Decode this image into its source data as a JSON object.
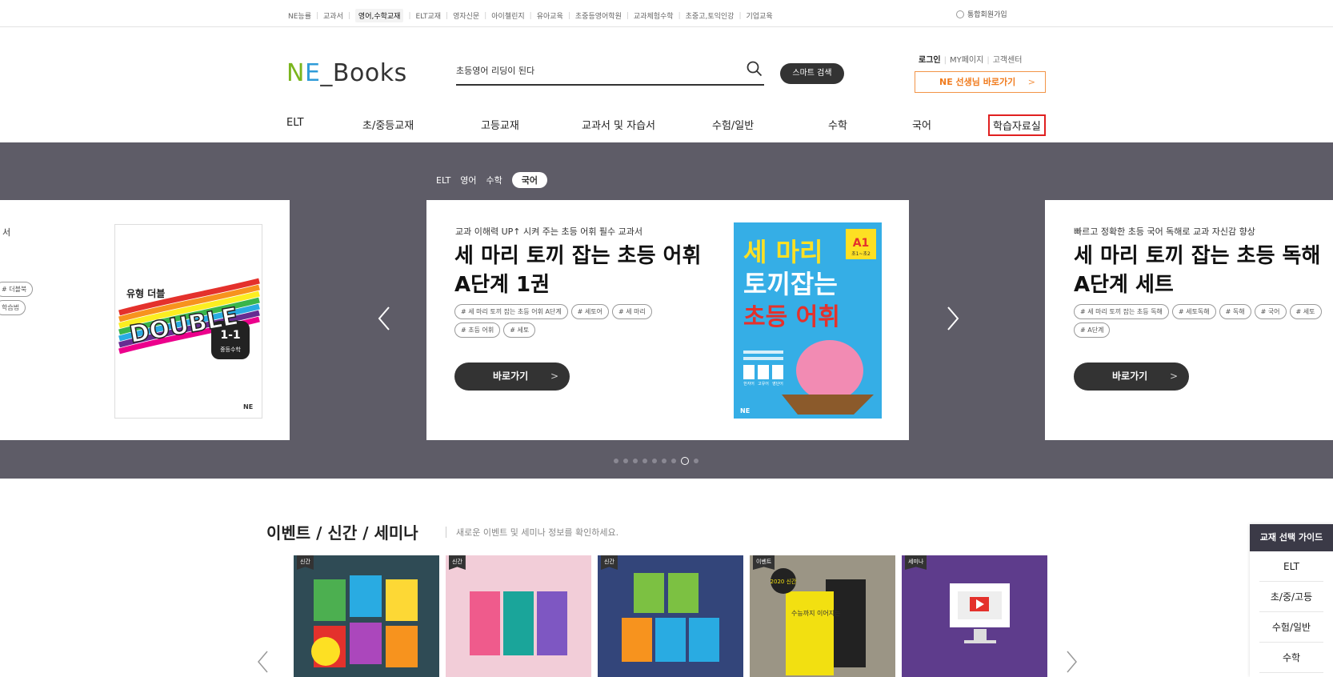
{
  "topbar": {
    "links": [
      "NE능률",
      "교과서",
      "영어,수학교재",
      "ELT교재",
      "영자신문",
      "아이첼린지",
      "유아교육",
      "초중등영어학원",
      "교과체험수학",
      "초중고,토익인강",
      "기업교육"
    ],
    "active_index": 2,
    "join": "통합회원가입"
  },
  "header": {
    "logo": {
      "n": "N",
      "e": "E",
      "u": "_",
      "books": "Books"
    },
    "search_value": "초등영어 리딩이 된다",
    "smart_search": "스마트 검색",
    "login": "로그인",
    "mypage": "MY페이지",
    "customer": "고객센터",
    "teacher": "NE 선생님 바로가기",
    "chevron": ">"
  },
  "nav": {
    "items": [
      "ELT",
      "초/중등교재",
      "고등교재",
      "교과서 및 자습서",
      "수험/일반",
      "수학",
      "국어",
      "학습자료실"
    ],
    "highlighted_index": 7
  },
  "hero": {
    "tabs": [
      "ELT",
      "영어",
      "수학",
      "국어"
    ],
    "active_tab": 3,
    "left": {
      "kicker": "서",
      "tags": [
        "# 더블북",
        "학습법"
      ],
      "cover": {
        "brand": "유형 더블",
        "word": "DOUBLE",
        "grade": "1-1",
        "subject": "중등수학",
        "publisher": "NE"
      }
    },
    "center": {
      "kicker": "교과 이해력 UP↑ 시켜 주는 초등 어휘 필수 교과서",
      "title_line1": "세 마리 토끼 잡는 초등 어휘",
      "title_line2": "A단계 1권",
      "tags": [
        "# 세 마리 토끼 잡는 초등 어휘 A단계",
        "# 세토어",
        "# 세 마리",
        "# 초등 어휘",
        "# 세토"
      ],
      "button": "바로가기",
      "cover": {
        "line1": "세 마리",
        "line2": "토끼잡는",
        "line3": "초등 어휘",
        "level": "A1",
        "level_sub": "초1~초2",
        "chips": [
          "한자어",
          "고유어",
          "영단어"
        ],
        "publisher": "NE"
      }
    },
    "right": {
      "kicker": "빠르고 정확한 초등 국어 독해로 교과 자신감 향상",
      "title_line1": "세 마리 토끼 잡는 초등 독해",
      "title_line2": "A단계 세트",
      "tags": [
        "# 세 마리 토끼 잡는 초등 독해",
        "# 세토독해",
        "# 독해",
        "# 국어",
        "# 세토",
        "# A단계"
      ],
      "button": "바로가기"
    },
    "dots_total": 9,
    "dots_active": 7
  },
  "events": {
    "title": "이벤트 / 신간 / 세미나",
    "subtitle": "새로운 이벤트 및 세미나 정보를 확인하세요.",
    "cards": [
      {
        "badge": "신간",
        "bg": "#2f4b55"
      },
      {
        "badge": "신간",
        "bg": "#f2cdd8"
      },
      {
        "badge": "신간",
        "bg": "#33457a"
      },
      {
        "badge": "이벤트",
        "bg": "#9b9585",
        "seal": "2020 신간",
        "book": "수능까지 이어지는"
      },
      {
        "badge": "세미나",
        "bg": "#5e3c8c"
      }
    ]
  },
  "guide": {
    "title": "교재 선택 가이드",
    "items": [
      "ELT",
      "초/중/고등",
      "수험/일반",
      "수학"
    ]
  },
  "colors": {
    "hero_bg": "#5e5c67",
    "accent_orange": "#f07a1c",
    "highlight_red": "#e02020",
    "dark": "#333333"
  }
}
